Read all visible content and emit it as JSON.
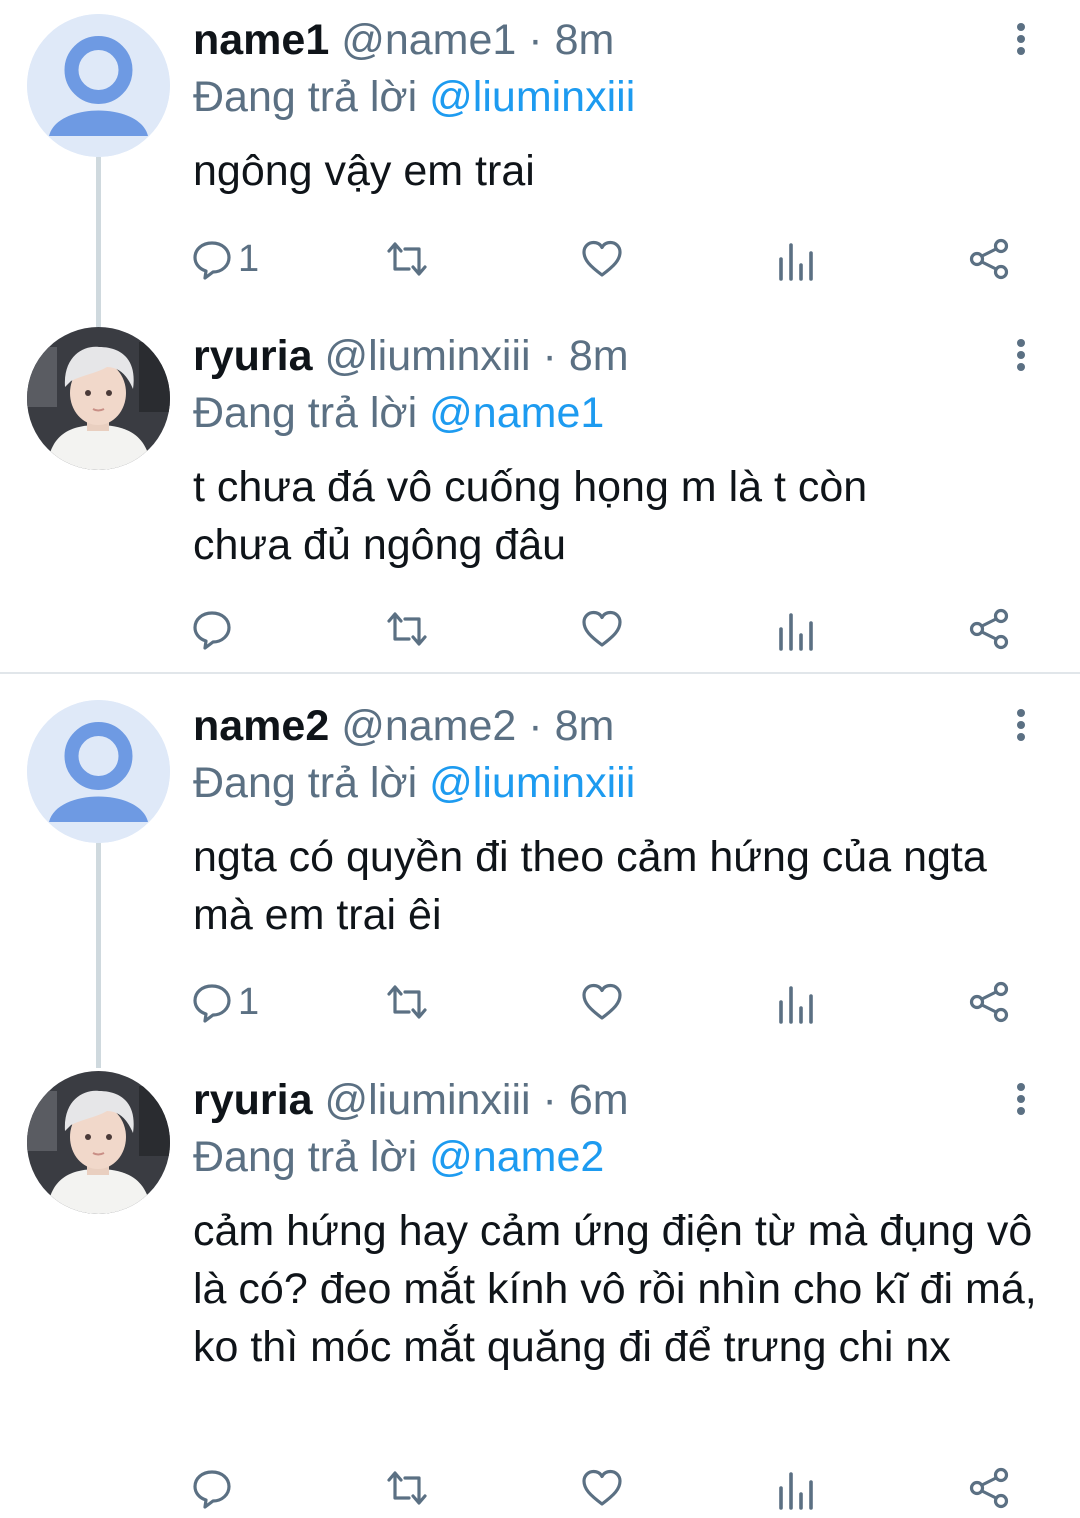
{
  "reply_prefix": "Đang trả lời",
  "threads": [
    {
      "parent": {
        "name": "name1",
        "handle": "@name1",
        "time": "8m",
        "reply_to": "@liuminxiii",
        "text": "ngông vậy em trai",
        "reply_count": "1"
      },
      "reply": {
        "name": "ryuria",
        "handle": "@liuminxiii",
        "time": "8m",
        "reply_to": "@name1",
        "text": "t chưa đá vô cuống họng m là t còn chưa đủ ngông đâu",
        "reply_count": ""
      }
    },
    {
      "parent": {
        "name": "name2",
        "handle": "@name2",
        "time": "8m",
        "reply_to": "@liuminxiii",
        "text": "ngta có quyền đi theo cảm hứng của ngta mà em trai êi",
        "reply_count": "1"
      },
      "reply": {
        "name": "ryuria",
        "handle": "@liuminxiii",
        "time": "6m",
        "reply_to": "@name2",
        "text": "cảm hứng hay cảm ứng điện từ mà đụng vô là có? đeo mắt kính vô rồi nhìn cho kĩ đi má, ko thì móc mắt quăng đi để trưng chi nx",
        "reply_count": ""
      }
    }
  ],
  "icons": {
    "reply": "reply-icon",
    "retweet": "retweet-icon",
    "like": "heart-icon",
    "analytics": "analytics-icon",
    "share": "share-icon",
    "more": "more-vertical-icon"
  },
  "colors": {
    "text": "#0f1419",
    "muted": "#5b7083",
    "link": "#1d9bf0",
    "thread_line": "#cfd9de",
    "default_avatar": "#6e9ae3"
  }
}
